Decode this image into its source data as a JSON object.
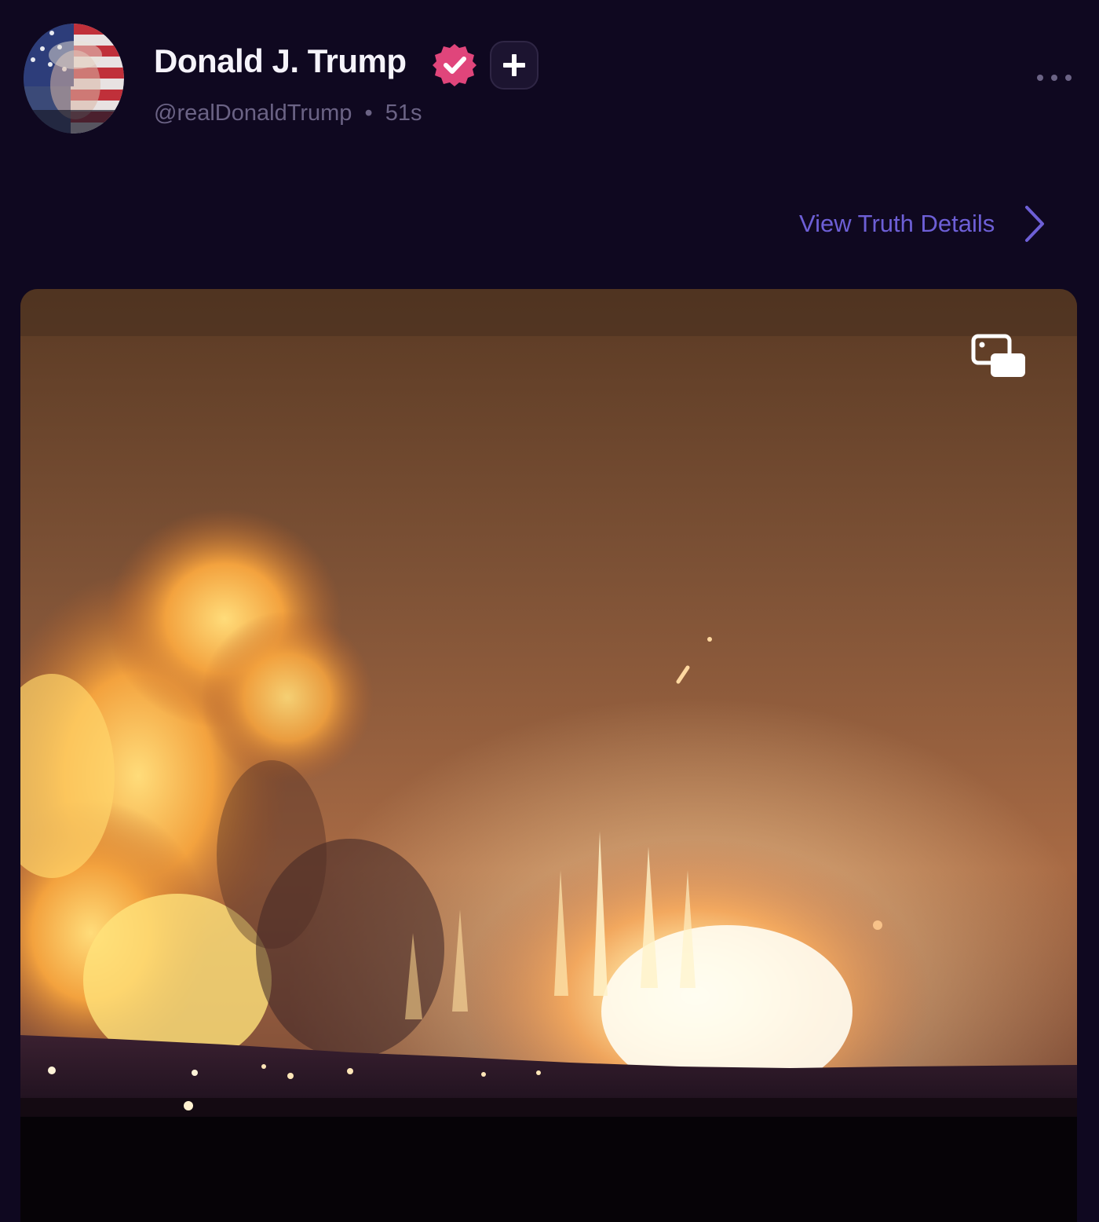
{
  "post": {
    "author": {
      "display_name": "Donald J. Trump",
      "handle": "@realDonaldTrump",
      "separator": "•",
      "time_ago": "51s",
      "verified": true
    },
    "view_details_label": "View Truth Details",
    "media": {
      "type": "video",
      "overlay_icon": "picture-in-picture-icon"
    }
  },
  "colors": {
    "background": "#0f0820",
    "link": "#6d5fd6",
    "verified_badge": "#e0457b",
    "name_text": "#f5f3fa",
    "handle_text": "#6b6385"
  },
  "icons": {
    "verified": "verified-badge-icon",
    "follow": "plus-icon",
    "more": "ellipsis-icon",
    "details": "chevron-right-icon"
  }
}
